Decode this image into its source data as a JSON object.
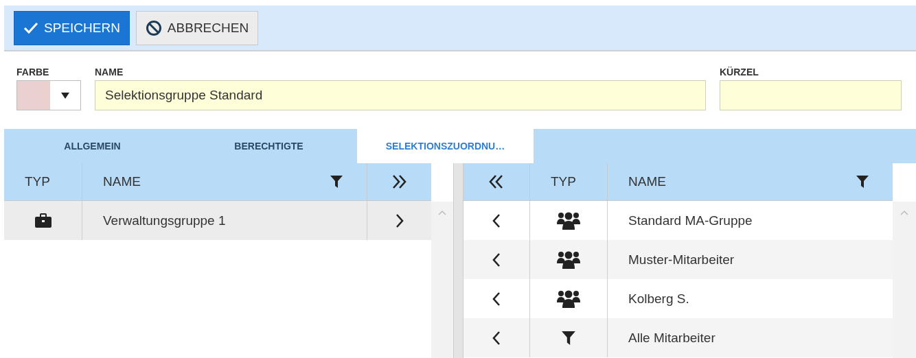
{
  "toolbar": {
    "buttons": [
      {
        "kind": "save",
        "label": "SPEICHERN"
      },
      {
        "kind": "cancel",
        "label": "ABBRECHEN"
      }
    ]
  },
  "form": {
    "farbe": {
      "label": "FARBE",
      "color": "#ebd0d1"
    },
    "name": {
      "label": "NAME",
      "value": "Selektionsgruppe Standard"
    },
    "kuerzel": {
      "label": "KÜRZEL"
    }
  },
  "tabs": [
    {
      "label": "ALLGEMEIN",
      "selected": false
    },
    {
      "label": "BERECHTIGTE",
      "selected": false
    },
    {
      "label": "SELEKTIONSZUORDNU…",
      "selected": true
    }
  ],
  "left_table": {
    "columns": [
      "TYP",
      "NAME"
    ],
    "rows": [
      {
        "kind": "briefcase",
        "name": "Verwaltungsgruppe 1"
      }
    ]
  },
  "right_table": {
    "columns": [
      "TYP",
      "NAME"
    ],
    "rows": [
      {
        "kind": "group",
        "name": "Standard MA-Gruppe"
      },
      {
        "kind": "group",
        "name": "Muster-Mitarbeiter"
      },
      {
        "kind": "group",
        "name": "Kolberg S."
      },
      {
        "kind": "filter",
        "name": "Alle Mitarbeiter"
      }
    ]
  }
}
